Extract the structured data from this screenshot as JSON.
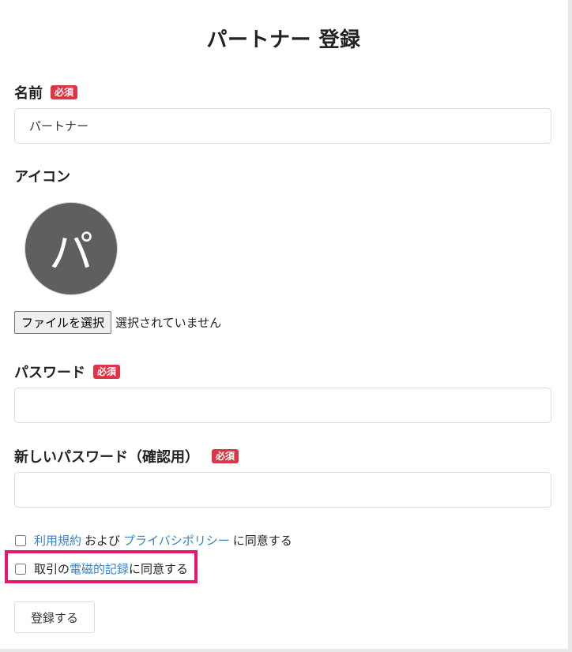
{
  "page": {
    "title": "パートナー 登録"
  },
  "form": {
    "required_badge": "必須",
    "name": {
      "label": "名前",
      "value": "パートナー"
    },
    "icon": {
      "label": "アイコン",
      "avatar_letter": "パ"
    },
    "file": {
      "button_label": "ファイルを選択",
      "status": "選択されていません"
    },
    "password": {
      "label": "パスワード",
      "value": ""
    },
    "password_confirm": {
      "label": "新しいパスワード（確認用）",
      "value": ""
    },
    "terms": {
      "checked": false,
      "terms_link": "利用規約",
      "and_text": "および",
      "privacy_link": "プライバシポリシー",
      "agree_text": "に同意する"
    },
    "electronic": {
      "checked": false,
      "prefix": "取引の",
      "link": "電磁的記録",
      "suffix": "に同意する"
    },
    "submit_label": "登録する"
  },
  "colors": {
    "badge": "#dc3545",
    "link": "#3b82c4",
    "highlight_border": "#e8186b",
    "avatar_bg": "#5f5f5f"
  }
}
